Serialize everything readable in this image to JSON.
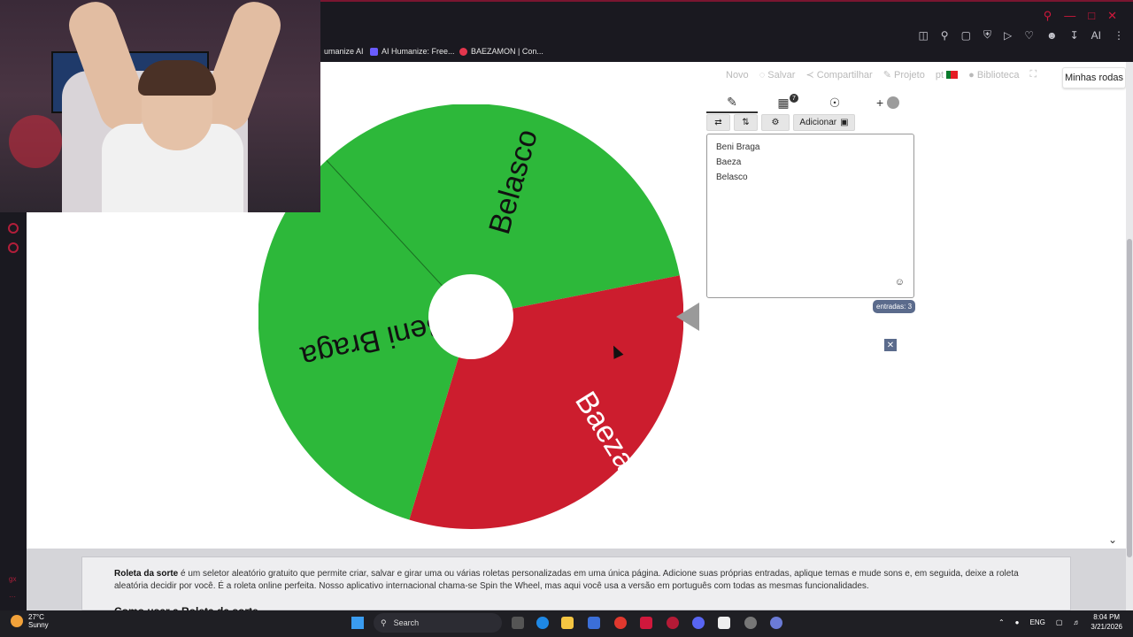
{
  "browser": {
    "bookmarks": [
      {
        "label": "umanize AI",
        "color": "#cccccc"
      },
      {
        "label": "AI Humanize: Free...",
        "color": "#6a5cff"
      },
      {
        "label": "BAEZAMON | Con...",
        "color": "#e3364d"
      }
    ],
    "toolbar_right_ai": "AI"
  },
  "nav": {
    "novo": "Novo",
    "salvar": "Salvar",
    "compartilhar": "Compartilhar",
    "projeto": "Projeto",
    "lang": "pt",
    "biblioteca": "Biblioteca",
    "minhas_rodas": "Minhas rodas"
  },
  "tabs": {
    "entries_badge": "7"
  },
  "toolbar": {
    "adicionar": "Adicionar"
  },
  "entries": [
    "Beni Braga",
    "Baeza",
    "Belasco"
  ],
  "entries_count": "entradas: 3",
  "wheel": {
    "segments": [
      {
        "label": "Belasco",
        "color": "#2db83a",
        "text_color": "#111111"
      },
      {
        "label": "Baeza",
        "color": "#cc1d2e",
        "text_color": "#ffffff"
      },
      {
        "label": "Beni Braga",
        "color": "#2db83a",
        "text_color": "#111111"
      }
    ]
  },
  "description": {
    "bold": "Roleta da sorte",
    "text": " é um seletor aleatório gratuito que permite criar, salvar e girar uma ou várias roletas personalizadas em uma única página. Adicione suas próprias entradas, aplique temas e mude sons e, em seguida, deixe a roleta aleatória decidir por você. É a roleta online perfeita. Nosso aplicativo internacional chama-se Spin the Wheel, mas aqui você usa a versão em português com todas as mesmas funcionalidades.",
    "heading": "Como usar a Roleta da sorte"
  },
  "taskbar": {
    "temp": "27°C",
    "weather": "Sunny",
    "search": "Search",
    "lang": "ENG",
    "time": "8:04 PM",
    "date": "3/21/2026"
  }
}
